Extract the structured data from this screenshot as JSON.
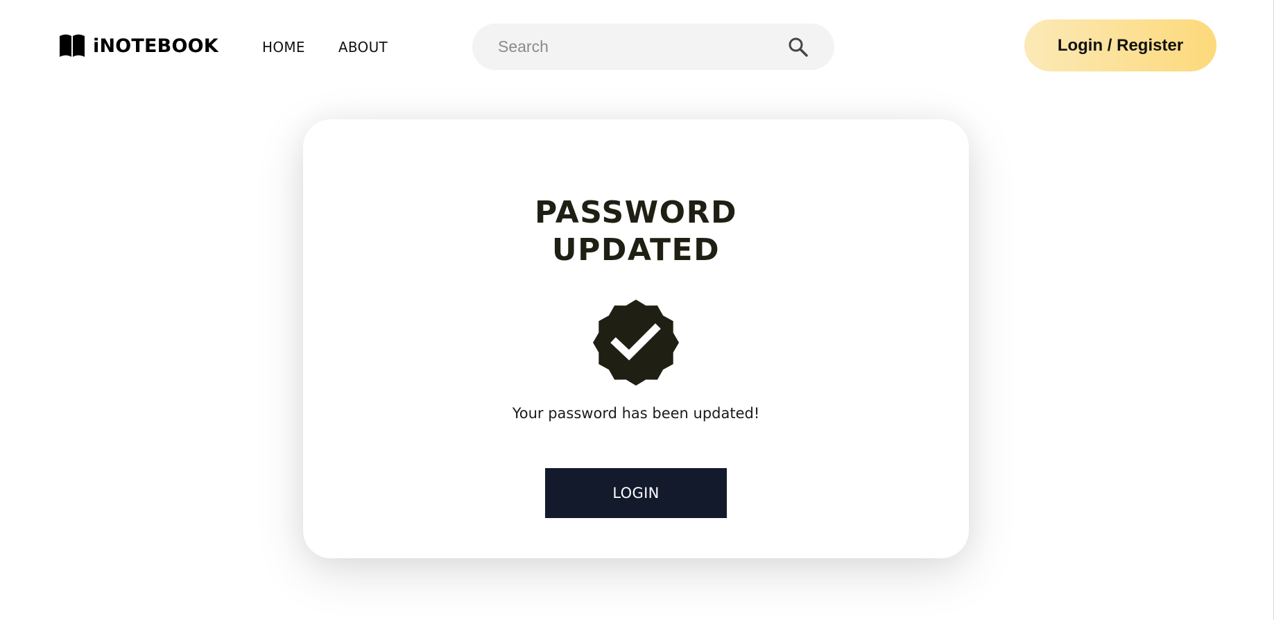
{
  "header": {
    "brand": "iNOTEBOOK",
    "brand_icon": "open-book-icon",
    "nav": {
      "home": "HOME",
      "about": "ABOUT"
    },
    "search": {
      "placeholder": "Search",
      "value": "",
      "icon": "search-icon"
    },
    "login_register_label": "Login / Register"
  },
  "card": {
    "title_line1": "PASSWORD",
    "title_line2": "UPDATED",
    "badge_icon": "verified-badge-check-icon",
    "message": "Your password has been updated!",
    "login_label": "LOGIN"
  },
  "colors": {
    "primary_button": "#121a2c",
    "title_text": "#1f1f14",
    "badge": "#1f1f14",
    "cta_gradient_start": "#fbe9b7",
    "cta_gradient_end": "#fcd97a",
    "search_bg": "#f3f3f3"
  }
}
